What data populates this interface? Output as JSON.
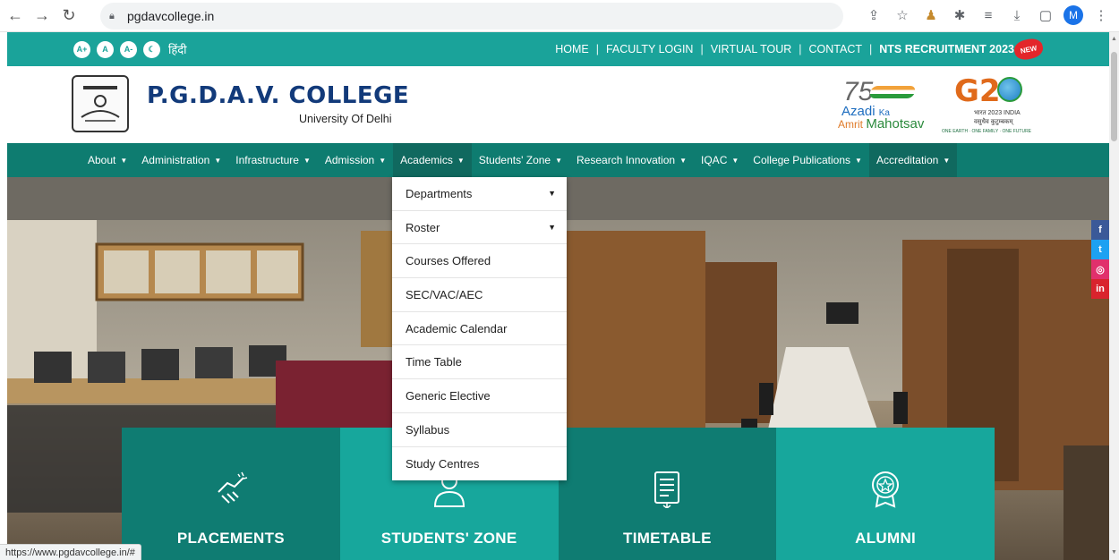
{
  "browser": {
    "url": "pgdavcollege.in",
    "profile_initial": "M",
    "status_url": "https://www.pgdavcollege.in/#"
  },
  "accessibility": {
    "increase": "A+",
    "normal": "A",
    "decrease": "A-",
    "language": "हिंदी"
  },
  "toplinks": [
    "HOME",
    "FACULTY LOGIN",
    "VIRTUAL TOUR",
    "CONTACT"
  ],
  "recruitment": "NTS RECRUITMENT 2023",
  "new_badge": "NEW",
  "header": {
    "name": "P.G.D.A.V. COLLEGE",
    "university": "University Of Delhi"
  },
  "azadi": {
    "number": "75",
    "line1": "Azadi",
    "ka": "Ka",
    "amrit": "Amrit",
    "mahotsav": "Mahotsav"
  },
  "g20": {
    "title": "G20",
    "line1": "भारत 2023 INDIA",
    "line2": "वसुधैव कुटुम्बकम्",
    "line3": "ONE EARTH · ONE FAMILY · ONE FUTURE"
  },
  "nav": [
    {
      "label": "About"
    },
    {
      "label": "Administration"
    },
    {
      "label": "Infrastructure"
    },
    {
      "label": "Admission"
    },
    {
      "label": "Academics"
    },
    {
      "label": "Students' Zone"
    },
    {
      "label": "Research Innovation"
    },
    {
      "label": "IQAC"
    },
    {
      "label": "College Publications"
    },
    {
      "label": "Accreditation"
    }
  ],
  "dropdown": [
    {
      "label": "Departments"
    },
    {
      "label": "Roster"
    },
    {
      "label": "Courses Offered"
    },
    {
      "label": "SEC/VAC/AEC"
    },
    {
      "label": "Academic Calendar"
    },
    {
      "label": "Time Table"
    },
    {
      "label": "Generic Elective"
    },
    {
      "label": "Syllabus"
    },
    {
      "label": "Study Centres"
    }
  ],
  "tiles": [
    {
      "label": "PLACEMENTS",
      "color": "#0f7c72"
    },
    {
      "label": "STUDENTS' ZONE",
      "color": "#17a79c"
    },
    {
      "label": "TIMETABLE",
      "color": "#0f7c72"
    },
    {
      "label": "ALUMNI",
      "color": "#17a79c"
    }
  ],
  "social": {
    "facebook": "f",
    "twitter": "t",
    "instagram": "◎",
    "linkedin": "in"
  },
  "colors": {
    "teal": "#1aa39a",
    "dark_teal": "#0e7c70",
    "brand_blue": "#123a7a"
  }
}
